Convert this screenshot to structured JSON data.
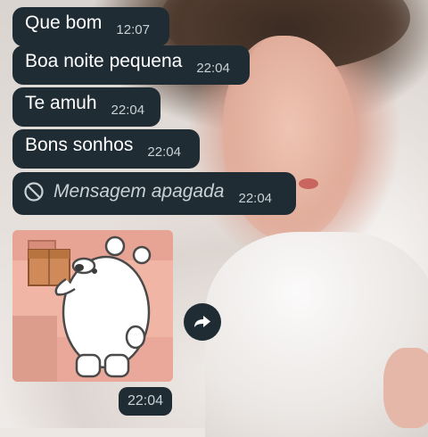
{
  "messages": [
    {
      "text": "Que bom",
      "time": "12:07"
    },
    {
      "text": "Boa noite pequena",
      "time": "22:04"
    },
    {
      "text": "Te amuh",
      "time": "22:04"
    },
    {
      "text": "Bons sonhos",
      "time": "22:04"
    },
    {
      "text": "Mensagem apagada",
      "time": "22:04",
      "deleted": true,
      "icon": "ban-icon"
    }
  ],
  "sticker": {
    "time": "22:04",
    "description_icon": "polar-bear-sticker"
  },
  "forward": {
    "icon": "forward-icon"
  },
  "colors": {
    "bubble": "#1f2c34",
    "text": "#ffffff",
    "meta": "#c9d1d5"
  }
}
